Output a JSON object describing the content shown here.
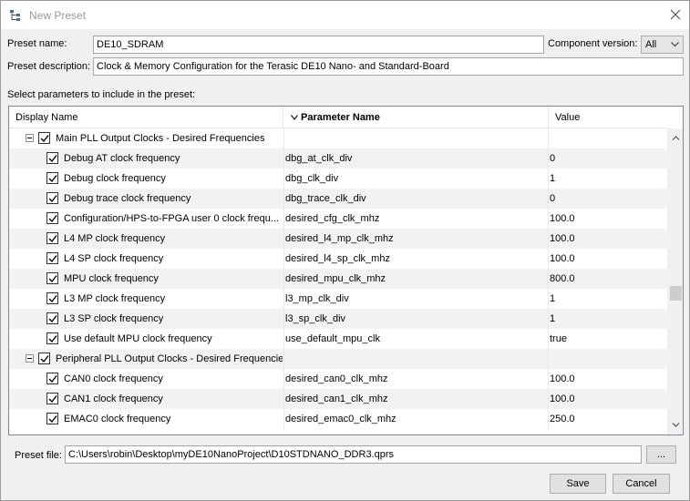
{
  "window": {
    "title": "New Preset"
  },
  "form": {
    "preset_name_label": "Preset name:",
    "preset_name_value": "DE10_SDRAM",
    "component_version_label": "Component version:",
    "component_version_value": "All",
    "preset_description_label": "Preset description:",
    "preset_description_value": "Clock & Memory Configuration for the Terasic DE10 Nano- and Standard-Board",
    "select_params_label": "Select parameters to include in the preset:"
  },
  "table": {
    "headers": {
      "display_name": "Display Name",
      "parameter_name": "Parameter Name",
      "value": "Value"
    },
    "rows": [
      {
        "type": "group",
        "display": "Main PLL Output Clocks - Desired Frequencies",
        "param": "",
        "value": ""
      },
      {
        "type": "item",
        "display": "Debug AT clock frequency",
        "param": "dbg_at_clk_div",
        "value": "0"
      },
      {
        "type": "item",
        "display": "Debug clock frequency",
        "param": "dbg_clk_div",
        "value": "1"
      },
      {
        "type": "item",
        "display": "Debug trace clock frequency",
        "param": "dbg_trace_clk_div",
        "value": "0"
      },
      {
        "type": "item",
        "display": "Configuration/HPS-to-FPGA user 0 clock frequ...",
        "param": "desired_cfg_clk_mhz",
        "value": "100.0"
      },
      {
        "type": "item",
        "display": "L4 MP clock frequency",
        "param": "desired_l4_mp_clk_mhz",
        "value": "100.0"
      },
      {
        "type": "item",
        "display": "L4 SP clock frequency",
        "param": "desired_l4_sp_clk_mhz",
        "value": "100.0"
      },
      {
        "type": "item",
        "display": "MPU clock frequency",
        "param": "desired_mpu_clk_mhz",
        "value": "800.0"
      },
      {
        "type": "item",
        "display": "L3 MP clock frequency",
        "param": "l3_mp_clk_div",
        "value": "1"
      },
      {
        "type": "item",
        "display": "L3 SP clock frequency",
        "param": "l3_sp_clk_div",
        "value": "1"
      },
      {
        "type": "item",
        "display": "Use default MPU clock frequency",
        "param": "use_default_mpu_clk",
        "value": "true"
      },
      {
        "type": "group",
        "display": "Peripheral PLL Output Clocks - Desired Frequencies",
        "param": "",
        "value": ""
      },
      {
        "type": "item",
        "display": "CAN0 clock frequency",
        "param": "desired_can0_clk_mhz",
        "value": "100.0"
      },
      {
        "type": "item",
        "display": "CAN1 clock frequency",
        "param": "desired_can1_clk_mhz",
        "value": "100.0"
      },
      {
        "type": "item",
        "display": "EMAC0 clock frequency",
        "param": "desired_emac0_clk_mhz",
        "value": "250.0"
      }
    ]
  },
  "footer": {
    "preset_file_label": "Preset file:",
    "preset_file_value": "C:\\Users\\robin\\Desktop\\myDE10NanoProject\\D10STDNANO_DDR3.qprs",
    "browse_label": "...",
    "save_label": "Save",
    "cancel_label": "Cancel"
  }
}
